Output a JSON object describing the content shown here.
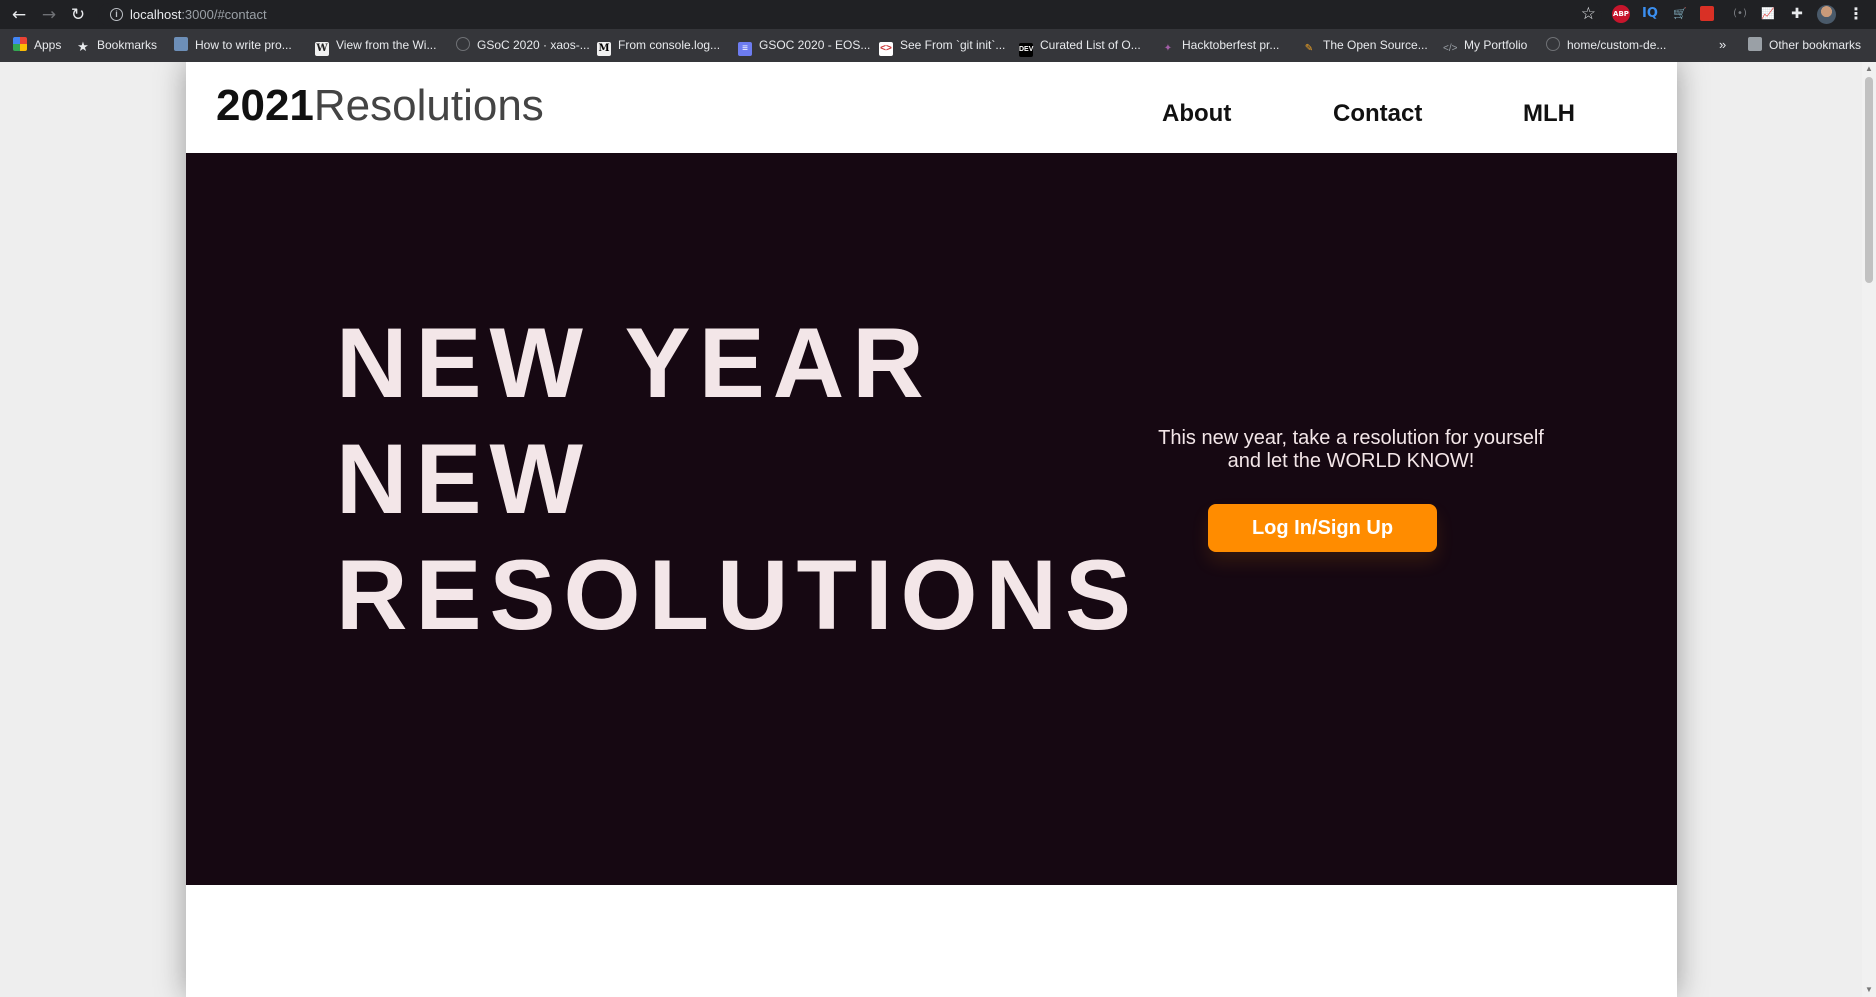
{
  "browser": {
    "url_host": "localhost",
    "url_path": ":3000/#contact",
    "bookmarks": [
      {
        "label": "Apps",
        "icon": "apps-grid-icon"
      },
      {
        "label": "Bookmarks",
        "icon": "star-icon"
      },
      {
        "label": "How to write pro...",
        "icon": "profile-image-icon"
      },
      {
        "label": "View from the Wi...",
        "icon": "wikipedia-icon"
      },
      {
        "label": "GSoC 2020 · xaos-...",
        "icon": "github-icon"
      },
      {
        "label": "From console.log...",
        "icon": "medium-icon"
      },
      {
        "label": "GSOC 2020 - EOS...",
        "icon": "docs-icon"
      },
      {
        "label": "See From `git init`...",
        "icon": "git-icon"
      },
      {
        "label": "Curated List of O...",
        "icon": "dev-icon"
      },
      {
        "label": "Hacktoberfest pr...",
        "icon": "hacktoberfest-icon"
      },
      {
        "label": "The Open Source...",
        "icon": "pencil-icon"
      },
      {
        "label": "My Portfolio",
        "icon": "code-icon"
      },
      {
        "label": "home/custom-de...",
        "icon": "github-icon"
      }
    ],
    "overflow_chevron": "»",
    "other_bookmarks": "Other bookmarks",
    "extensions": {
      "abp": "ABP",
      "iq": "IQ"
    }
  },
  "site": {
    "logo_year": "2021",
    "logo_word": "Resolutions",
    "nav": [
      "About",
      "Contact",
      "MLH"
    ]
  },
  "hero": {
    "title_lines": [
      "NEW YEAR",
      "NEW",
      "RESOLUTIONS"
    ],
    "tagline": "This new year, take a resolution for yourself and let the WORLD KNOW!",
    "cta_label": "Log In/Sign Up"
  },
  "colors": {
    "hero_background": "#160812",
    "hero_text": "#f3e6e8",
    "cta_background": "#ff8c00",
    "chrome_background": "#202124"
  }
}
